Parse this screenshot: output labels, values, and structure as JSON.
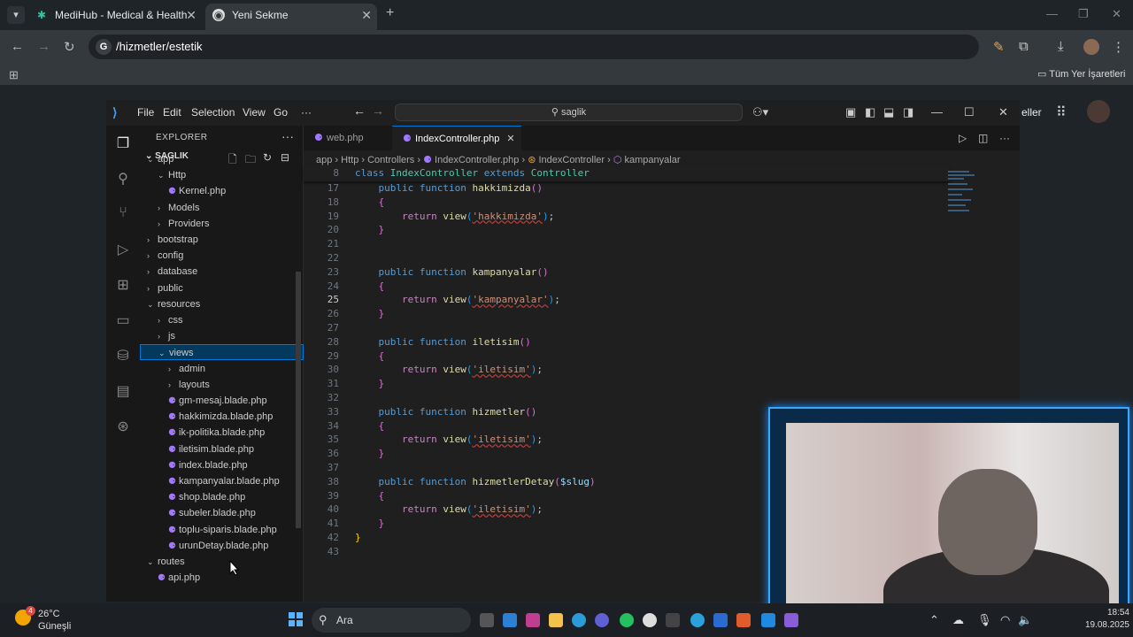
{
  "browser": {
    "tabs": [
      {
        "title": "MediHub - Medical & Health Th",
        "favicon": "medihub-icon"
      },
      {
        "title": "Yeni Sekme",
        "favicon": "chrome-icon",
        "active": true
      }
    ],
    "url": "/hizmetler/estetik",
    "bookmarks_all": "Tüm Yer İşaretleri",
    "right_peek_text": "eller"
  },
  "vscode": {
    "menu": [
      "File",
      "Edit",
      "Selection",
      "View",
      "Go",
      "···"
    ],
    "search": "saglik",
    "explorer_title": "EXPLORER",
    "workspace": "SAGLIK",
    "tree": [
      {
        "label": "app",
        "depth": 0,
        "kind": "folder-open"
      },
      {
        "label": "Http",
        "depth": 1,
        "kind": "folder-open"
      },
      {
        "label": "Kernel.php",
        "depth": 2,
        "kind": "php"
      },
      {
        "label": "Models",
        "depth": 1,
        "kind": "folder"
      },
      {
        "label": "Providers",
        "depth": 1,
        "kind": "folder"
      },
      {
        "label": "bootstrap",
        "depth": 0,
        "kind": "folder"
      },
      {
        "label": "config",
        "depth": 0,
        "kind": "folder"
      },
      {
        "label": "database",
        "depth": 0,
        "kind": "folder"
      },
      {
        "label": "public",
        "depth": 0,
        "kind": "folder"
      },
      {
        "label": "resources",
        "depth": 0,
        "kind": "folder-open"
      },
      {
        "label": "css",
        "depth": 1,
        "kind": "folder"
      },
      {
        "label": "js",
        "depth": 1,
        "kind": "folder"
      },
      {
        "label": "views",
        "depth": 1,
        "kind": "folder-open",
        "selected": true
      },
      {
        "label": "admin",
        "depth": 2,
        "kind": "folder"
      },
      {
        "label": "layouts",
        "depth": 2,
        "kind": "folder"
      },
      {
        "label": "gm-mesaj.blade.php",
        "depth": 2,
        "kind": "php"
      },
      {
        "label": "hakkimizda.blade.php",
        "depth": 2,
        "kind": "php"
      },
      {
        "label": "ik-politika.blade.php",
        "depth": 2,
        "kind": "php"
      },
      {
        "label": "iletisim.blade.php",
        "depth": 2,
        "kind": "php"
      },
      {
        "label": "index.blade.php",
        "depth": 2,
        "kind": "php"
      },
      {
        "label": "kampanyalar.blade.php",
        "depth": 2,
        "kind": "php"
      },
      {
        "label": "shop.blade.php",
        "depth": 2,
        "kind": "php"
      },
      {
        "label": "subeler.blade.php",
        "depth": 2,
        "kind": "php"
      },
      {
        "label": "toplu-siparis.blade.php",
        "depth": 2,
        "kind": "php"
      },
      {
        "label": "urunDetay.blade.php",
        "depth": 2,
        "kind": "php"
      },
      {
        "label": "routes",
        "depth": 0,
        "kind": "folder-open"
      },
      {
        "label": "api.php",
        "depth": 1,
        "kind": "php"
      }
    ],
    "editor_tabs": [
      {
        "label": "web.php",
        "active": false
      },
      {
        "label": "IndexController.php",
        "active": true
      }
    ],
    "breadcrumbs": [
      "app",
      "Http",
      "Controllers",
      "IndexController.php",
      "IndexController",
      "kampanyalar"
    ],
    "sticky_line": {
      "num": "8",
      "text": "class IndexController extends Controller"
    },
    "current_line": "25",
    "code": [
      {
        "num": "17",
        "t": "fdecl",
        "name": "hakkimizda",
        "arg": ""
      },
      {
        "num": "18",
        "t": "open"
      },
      {
        "num": "19",
        "t": "ret",
        "view": "hakkimizda"
      },
      {
        "num": "20",
        "t": "close"
      },
      {
        "num": "21",
        "t": "blank"
      },
      {
        "num": "22",
        "t": "blank"
      },
      {
        "num": "23",
        "t": "fdecl",
        "name": "kampanyalar",
        "arg": ""
      },
      {
        "num": "24",
        "t": "open"
      },
      {
        "num": "25",
        "t": "ret",
        "view": "kampanyalar"
      },
      {
        "num": "26",
        "t": "close"
      },
      {
        "num": "27",
        "t": "blank"
      },
      {
        "num": "28",
        "t": "fdecl",
        "name": "iletisim",
        "arg": ""
      },
      {
        "num": "29",
        "t": "open"
      },
      {
        "num": "30",
        "t": "ret",
        "view": "iletisim"
      },
      {
        "num": "31",
        "t": "close"
      },
      {
        "num": "32",
        "t": "blank"
      },
      {
        "num": "33",
        "t": "fdecl",
        "name": "hizmetler",
        "arg": ""
      },
      {
        "num": "34",
        "t": "open"
      },
      {
        "num": "35",
        "t": "ret",
        "view": "iletisim"
      },
      {
        "num": "36",
        "t": "close"
      },
      {
        "num": "37",
        "t": "blank"
      },
      {
        "num": "38",
        "t": "fdecl",
        "name": "hizmetlerDetay",
        "arg": "$slug"
      },
      {
        "num": "39",
        "t": "open"
      },
      {
        "num": "40",
        "t": "ret",
        "view": "iletisim"
      },
      {
        "num": "41",
        "t": "close"
      },
      {
        "num": "42",
        "t": "classclose"
      },
      {
        "num": "43",
        "t": "blank"
      }
    ],
    "kw_public": "public",
    "kw_function": "function",
    "kw_return": "return",
    "fn_view": "view"
  },
  "taskbar": {
    "weather_temp": "26°C",
    "weather_desc": "Güneşli",
    "weather_badge": "4",
    "search": "Ara",
    "time": "18:54",
    "date": "19.08.2025"
  },
  "colors": {
    "accent": "#0078d4",
    "cam_border": "#36a8ff"
  }
}
